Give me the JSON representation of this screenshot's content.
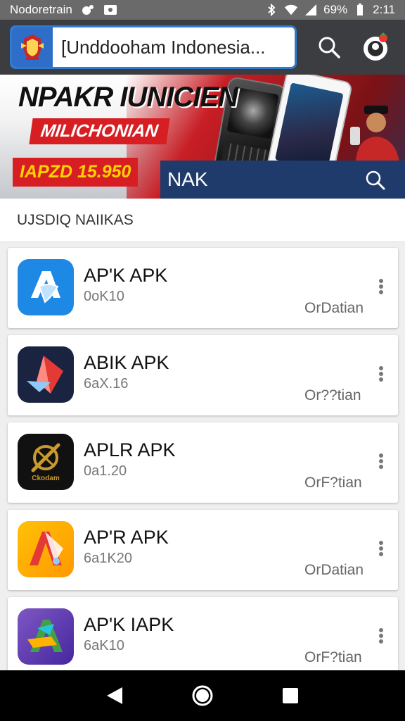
{
  "status_bar": {
    "carrier": "Nodoretrain",
    "battery": "69%",
    "time": "2:11"
  },
  "top_bar": {
    "search_value": "[Unddooham Indonesia...",
    "icons": [
      "search-icon",
      "profile-icon"
    ]
  },
  "banner": {
    "title": "NPAKR IUNICIEN",
    "subtitle": "MILICHONIAN",
    "price": "IAPZD 15.950",
    "nav_text": "NAK"
  },
  "section": {
    "title": "UJSDIQ NAIIKAS"
  },
  "apps": [
    {
      "name": "AP'K APK",
      "size": "0oK10",
      "action": "OrDatian",
      "colors": [
        "#1e88e5",
        "#4fb3ff"
      ]
    },
    {
      "name": "ABIK APK",
      "size": "6aX.16",
      "action": "Or??tian",
      "colors": [
        "#1a2340",
        "#e53935"
      ]
    },
    {
      "name": "APLR APK",
      "size": "0a1.20",
      "action": "OrF?tian",
      "colors": [
        "#111111",
        "#c99a2e"
      ],
      "icon_label": "Ckodam"
    },
    {
      "name": "AP'R APK",
      "size": "6a1K20",
      "action": "OrDatian",
      "colors": [
        "#ffb300",
        "#e53935"
      ]
    },
    {
      "name": "AP'K IAPK",
      "size": "6aK10",
      "action": "OrF?tian",
      "colors": [
        "#5e35b1",
        "#43a047"
      ]
    }
  ],
  "accent_color": "#2e7ad1"
}
